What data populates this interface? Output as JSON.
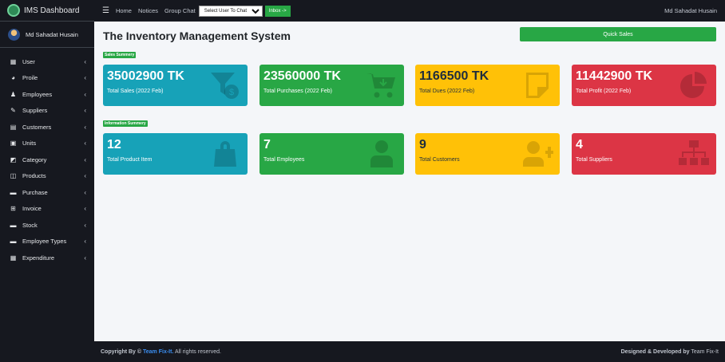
{
  "app": {
    "title": "IMS Dashboard"
  },
  "user": {
    "name": "Md Sahadat Husain"
  },
  "sidebar": {
    "items": [
      {
        "label": "User",
        "icon": "grid-icon"
      },
      {
        "label": "Proile",
        "icon": "pie-icon"
      },
      {
        "label": "Employees",
        "icon": "bell-icon"
      },
      {
        "label": "Suppliers",
        "icon": "edit-icon"
      },
      {
        "label": "Customers",
        "icon": "table-icon"
      },
      {
        "label": "Units",
        "icon": "calendar-icon"
      },
      {
        "label": "Category",
        "icon": "box-icon"
      },
      {
        "label": "Products",
        "icon": "columns-icon"
      },
      {
        "label": "Purchase",
        "icon": "book-icon"
      },
      {
        "label": "Invoice",
        "icon": "plus-box-icon"
      },
      {
        "label": "Stock",
        "icon": "book-icon"
      },
      {
        "label": "Employee Types",
        "icon": "book-icon"
      },
      {
        "label": "Expenditure",
        "icon": "grid-icon"
      }
    ]
  },
  "topbar": {
    "links": [
      "Home",
      "Notices",
      "Group Chat"
    ],
    "select_value": "Select User To Chat",
    "inbox_label": "Inbox ->",
    "user": "Md Sahadat Husain"
  },
  "main": {
    "title": "The Inventory Management System",
    "quick_sales_label": "Quick Sales",
    "sales_badge": "Sales Summery",
    "info_badge": "Information Summery",
    "sales_cards": [
      {
        "value": "35002900 TK",
        "label": "Total Sales (2022 Feb)",
        "icon": "funnel-dollar-icon",
        "color": "#17a2b8"
      },
      {
        "value": "23560000 TK",
        "label": "Total Purchases (2022 Feb)",
        "icon": "cart-icon",
        "color": "#28a745"
      },
      {
        "value": "1166500 TK",
        "label": "Total Dues (2022 Feb)",
        "icon": "sticky-note-icon",
        "color": "#ffc107"
      },
      {
        "value": "11442900 TK",
        "label": "Total Profit (2022 Feb)",
        "icon": "pie-chart-icon",
        "color": "#dc3545"
      }
    ],
    "info_cards": [
      {
        "value": "12",
        "label": "Total Product Item",
        "icon": "shopping-bag-icon",
        "color": "#17a2b8"
      },
      {
        "value": "7",
        "label": "Total Employees",
        "icon": "user-tie-icon",
        "color": "#28a745"
      },
      {
        "value": "9",
        "label": "Total Customers",
        "icon": "user-plus-icon",
        "color": "#ffc107"
      },
      {
        "value": "4",
        "label": "Total Suppliers",
        "icon": "sitemap-icon",
        "color": "#dc3545"
      }
    ]
  },
  "footer": {
    "copyright_prefix": "Copyright By ©",
    "team_link": "Team Fix-It.",
    "rights": "All rights reserved.",
    "designed_label": "Designed & Developed by",
    "designed_team": "Team Fix-It"
  }
}
